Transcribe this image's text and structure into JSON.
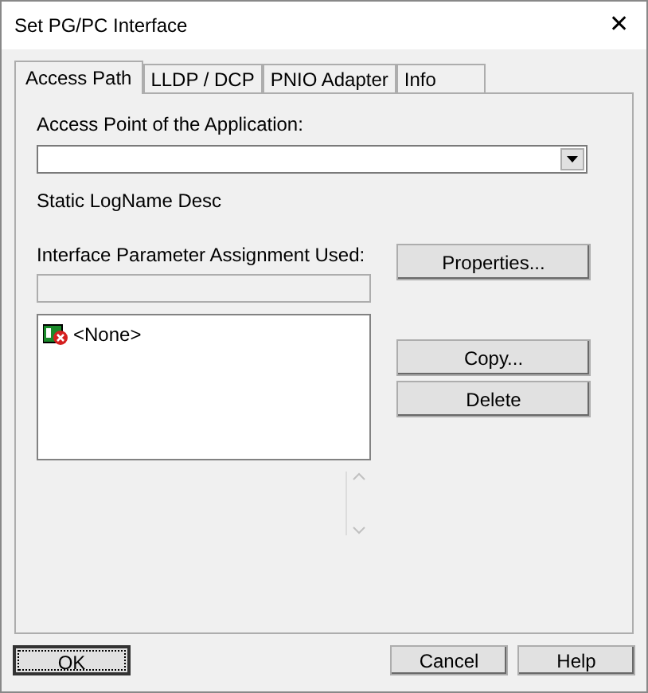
{
  "window": {
    "title": "Set PG/PC Interface",
    "close": "✕"
  },
  "tabs": [
    {
      "label": "Access Path",
      "selected": true
    },
    {
      "label": "LLDP / DCP",
      "selected": false
    },
    {
      "label": "PNIO Adapter",
      "selected": false
    },
    {
      "label": "Info",
      "selected": false
    }
  ],
  "access_point": {
    "label": "Access Point of the Application:"
  },
  "static_text": "Static LogName Desc",
  "assignment": {
    "label": "Interface Parameter Assignment Used:",
    "disabled": true
  },
  "list": {
    "items": [
      {
        "label": "<None>",
        "selected": false
      }
    ]
  },
  "side_buttons": [
    "Properties...",
    "Copy...",
    "Delete"
  ],
  "footer_buttons": [
    {
      "label": "OK",
      "default": true
    },
    {
      "label": "Cancel",
      "default": false
    },
    {
      "label": "Help",
      "default": false
    }
  ]
}
